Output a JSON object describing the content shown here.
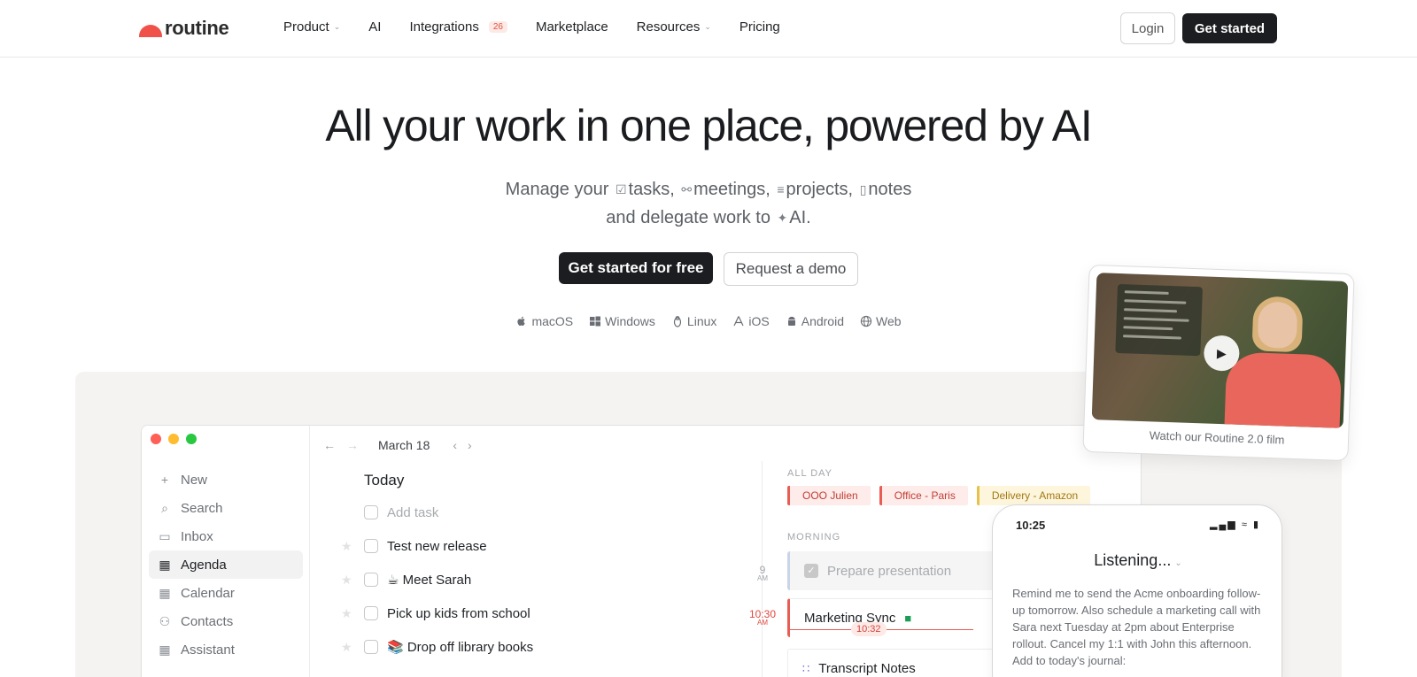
{
  "nav": {
    "logo_text": "routine",
    "links": [
      {
        "label": "Product",
        "has_dropdown": true
      },
      {
        "label": "AI"
      },
      {
        "label": "Integrations",
        "badge": "26"
      },
      {
        "label": "Marketplace"
      },
      {
        "label": "Resources",
        "has_dropdown": true
      },
      {
        "label": "Pricing"
      }
    ],
    "login_label": "Login",
    "get_started_label": "Get started"
  },
  "hero": {
    "title": "All your work in one place, powered by AI",
    "sub_prefix": "Manage your",
    "sub_tasks": "tasks,",
    "sub_meetings": "meetings,",
    "sub_projects": "projects,",
    "sub_notes": "notes",
    "sub_line2": "and delegate work to",
    "sub_ai": "AI.",
    "primary_cta": "Get started for free",
    "secondary_cta": "Request a demo"
  },
  "platforms": [
    {
      "label": "macOS",
      "icon": "apple-icon"
    },
    {
      "label": "Windows",
      "icon": "windows-icon"
    },
    {
      "label": "Linux",
      "icon": "linux-icon"
    },
    {
      "label": "iOS",
      "icon": "appstore-icon"
    },
    {
      "label": "Android",
      "icon": "android-icon"
    },
    {
      "label": "Web",
      "icon": "globe-icon"
    }
  ],
  "app": {
    "sidebar": [
      {
        "label": "New",
        "icon": "+"
      },
      {
        "label": "Search",
        "icon": "⌕"
      },
      {
        "label": "Inbox",
        "icon": "▭"
      },
      {
        "label": "Agenda",
        "icon": "▦",
        "active": true
      },
      {
        "label": "Calendar",
        "icon": "▦"
      },
      {
        "label": "Contacts",
        "icon": "⚇"
      },
      {
        "label": "Assistant",
        "icon": "▦"
      }
    ],
    "toolbar_date": "March 18",
    "today_label": "Today",
    "tasks": [
      {
        "label": "Add task",
        "placeholder": true
      },
      {
        "label": "Test new release"
      },
      {
        "label": "☕ Meet Sarah"
      },
      {
        "label": "Pick up kids from school"
      },
      {
        "label": "📚 Drop off library books"
      }
    ],
    "timeline": {
      "all_day_label": "ALL DAY",
      "all_day_events": [
        {
          "label": "OOO Julien",
          "color": "red"
        },
        {
          "label": "Office - Paris",
          "color": "red"
        },
        {
          "label": "Delivery - Amazon",
          "color": "yellow"
        }
      ],
      "morning_label": "MORNING",
      "hour_9": "9",
      "hour_9_ampm": "AM",
      "hour_1030": "10:30",
      "hour_1030_ampm": "AM",
      "now_time": "10:32",
      "events": [
        {
          "label": "Prepare presentation"
        },
        {
          "label": "Marketing Sync"
        },
        {
          "label": "Transcript Notes"
        }
      ]
    }
  },
  "video": {
    "caption": "Watch our Routine 2.0 film"
  },
  "phone": {
    "time": "10:25",
    "title": "Listening...",
    "body": "Remind me to send the Acme onboarding follow-up tomorrow. Also schedule a marketing call with Sara next Tuesday at 2pm about Enterprise rollout. Cancel my 1:1 with John this afternoon. Add to today's journal:"
  },
  "colors": {
    "brand": "#f0524a",
    "dark": "#1b1d20",
    "accent_red": "#e85d53"
  }
}
